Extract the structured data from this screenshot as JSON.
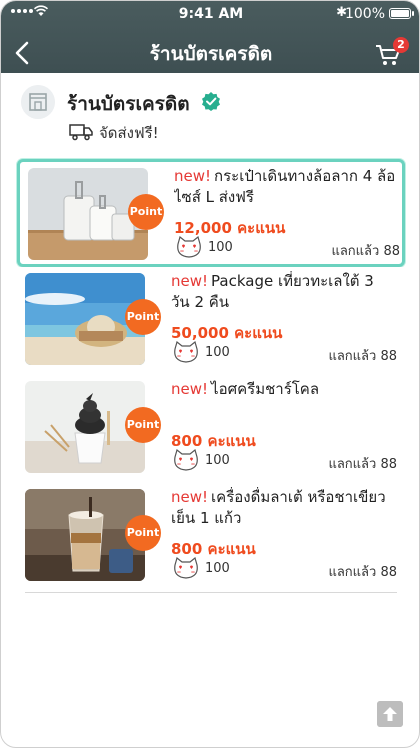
{
  "status_bar": {
    "time": "9:41 AM",
    "battery": "100%"
  },
  "header": {
    "title": "ร้านบัตรเครดิต",
    "cart_count": "2"
  },
  "store": {
    "name": "ร้านบัตรเครดิต",
    "shipping": "จัดส่งฟรี!"
  },
  "items": [
    {
      "new": "new!",
      "name": "กระเป๋าเดินทางล้อลาก 4 ล้อ ไซส์ L ส่งฟรี",
      "price": "12,000 คะแนน",
      "badge": "Point",
      "qty": "100",
      "redeemed": "แลกแล้ว 88"
    },
    {
      "new": "new!",
      "name": "Package เที่ยวทะเลใต้ 3 วัน 2 คืน",
      "price": "50,000 คะแนน",
      "badge": "Point",
      "qty": "100",
      "redeemed": "แลกแล้ว 88"
    },
    {
      "new": "new!",
      "name": "ไอศครีมชาร์โคล",
      "price": "800 คะแนน",
      "badge": "Point",
      "qty": "100",
      "redeemed": "แลกแล้ว 88"
    },
    {
      "new": "new!",
      "name": "เครื่องดื่มลาเต้ หรือชาเขียวเย็น 1 แก้ว",
      "price": "800 คะแนน",
      "badge": "Point",
      "qty": "100",
      "redeemed": "แลกแล้ว 88"
    }
  ],
  "colors": {
    "header_bg": "#3e4f52",
    "accent": "#ef4b1e",
    "badge": "#f26a21",
    "selected_border": "#6bd2bf",
    "new_label": "#e53935"
  }
}
